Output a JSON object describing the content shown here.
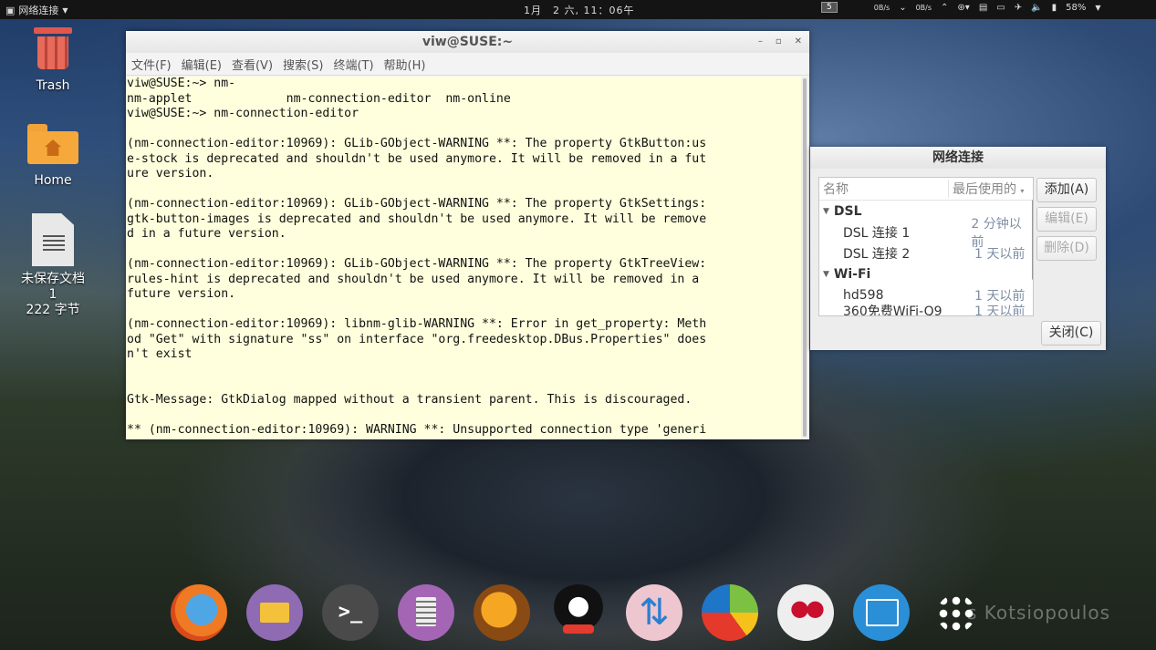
{
  "top_panel": {
    "network_label": "网络连接",
    "clock": "1月　2 六, 11：06午",
    "workspace": "5",
    "down_speed": "0B/s",
    "up_speed": "0B/s",
    "battery": "58%"
  },
  "desktop": {
    "trash_label": "Trash",
    "home_label": "Home",
    "doc_label_line1": "未保存文档",
    "doc_label_line2": "1",
    "doc_label_line3": "222 字节"
  },
  "terminal": {
    "title": "viw@SUSE:~",
    "menu": [
      "文件(F)",
      "编辑(E)",
      "查看(V)",
      "搜索(S)",
      "终端(T)",
      "帮助(H)"
    ],
    "lines": [
      "viw@SUSE:~> nm-",
      "nm-applet             nm-connection-editor  nm-online",
      "viw@SUSE:~> nm-connection-editor",
      "",
      "(nm-connection-editor:10969): GLib-GObject-WARNING **: The property GtkButton:us",
      "e-stock is deprecated and shouldn't be used anymore. It will be removed in a fut",
      "ure version.",
      "",
      "(nm-connection-editor:10969): GLib-GObject-WARNING **: The property GtkSettings:",
      "gtk-button-images is deprecated and shouldn't be used anymore. It will be remove",
      "d in a future version.",
      "",
      "(nm-connection-editor:10969): GLib-GObject-WARNING **: The property GtkTreeView:",
      "rules-hint is deprecated and shouldn't be used anymore. It will be removed in a",
      "future version.",
      "",
      "(nm-connection-editor:10969): libnm-glib-WARNING **: Error in get_property: Meth",
      "od \"Get\" with signature \"ss\" on interface \"org.freedesktop.DBus.Properties\" does",
      "n't exist",
      "",
      "",
      "Gtk-Message: GtkDialog mapped without a transient parent. This is discouraged.",
      "",
      "** (nm-connection-editor:10969): WARNING **: Unsupported connection type 'generi"
    ]
  },
  "network_dialog": {
    "title": "网络连接",
    "col_name": "名称",
    "col_last_used": "最后使用的",
    "groups": [
      {
        "name": "DSL",
        "items": [
          {
            "name": "DSL 连接 1",
            "last_used": "2 分钟以前"
          },
          {
            "name": "DSL 连接 2",
            "last_used": "1 天以前"
          }
        ]
      },
      {
        "name": "Wi-Fi",
        "items": [
          {
            "name": "hd598",
            "last_used": "1 天以前"
          },
          {
            "name": "360免费WiFi-Q9",
            "last_used": "1 天以前"
          }
        ]
      }
    ],
    "add_button": "添加(A)",
    "edit_button": "编辑(E)",
    "delete_button": "删除(D)",
    "close_button": "关闭(C)"
  },
  "watermark": "s Kotsiopoulos"
}
